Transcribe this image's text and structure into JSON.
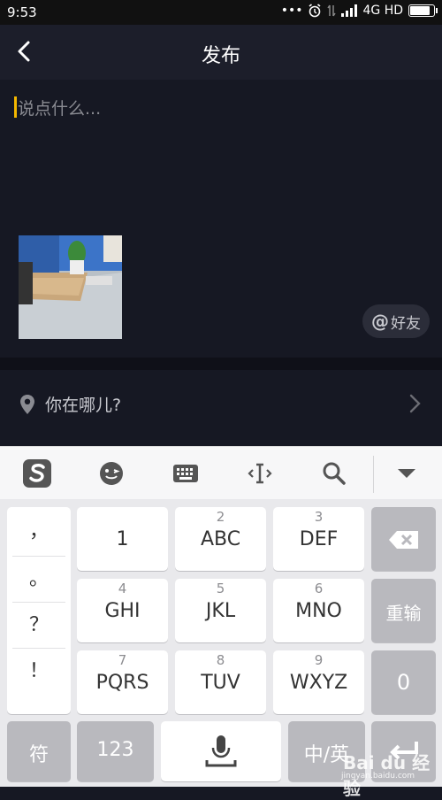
{
  "status_bar": {
    "time": "9:53",
    "network": "4G HD"
  },
  "header": {
    "title": "发布"
  },
  "compose": {
    "placeholder": "说点什么...",
    "mention_label": "好友"
  },
  "location": {
    "label": "你在哪儿?"
  },
  "keyboard": {
    "toolbar_icons": [
      "sogou-logo-icon",
      "emoji-icon",
      "keyboard-icon",
      "cursor-icon",
      "search-icon",
      "collapse-icon"
    ],
    "punctuation": [
      "，",
      "。",
      "？",
      "！"
    ],
    "keys": [
      {
        "sub": "",
        "main": "1"
      },
      {
        "sub": "2",
        "main": "ABC"
      },
      {
        "sub": "3",
        "main": "DEF"
      },
      {
        "sub": "4",
        "main": "GHI"
      },
      {
        "sub": "5",
        "main": "JKL"
      },
      {
        "sub": "6",
        "main": "MNO"
      },
      {
        "sub": "7",
        "main": "PQRS"
      },
      {
        "sub": "8",
        "main": "TUV"
      },
      {
        "sub": "9",
        "main": "WXYZ"
      }
    ],
    "reenter_label": "重输",
    "zero_label": "0",
    "symbol_label": "符",
    "num_label": "123",
    "lang_label": "中/英"
  },
  "watermark": {
    "brand": "Bai du 经验",
    "url": "jingyan.baidu.com"
  }
}
